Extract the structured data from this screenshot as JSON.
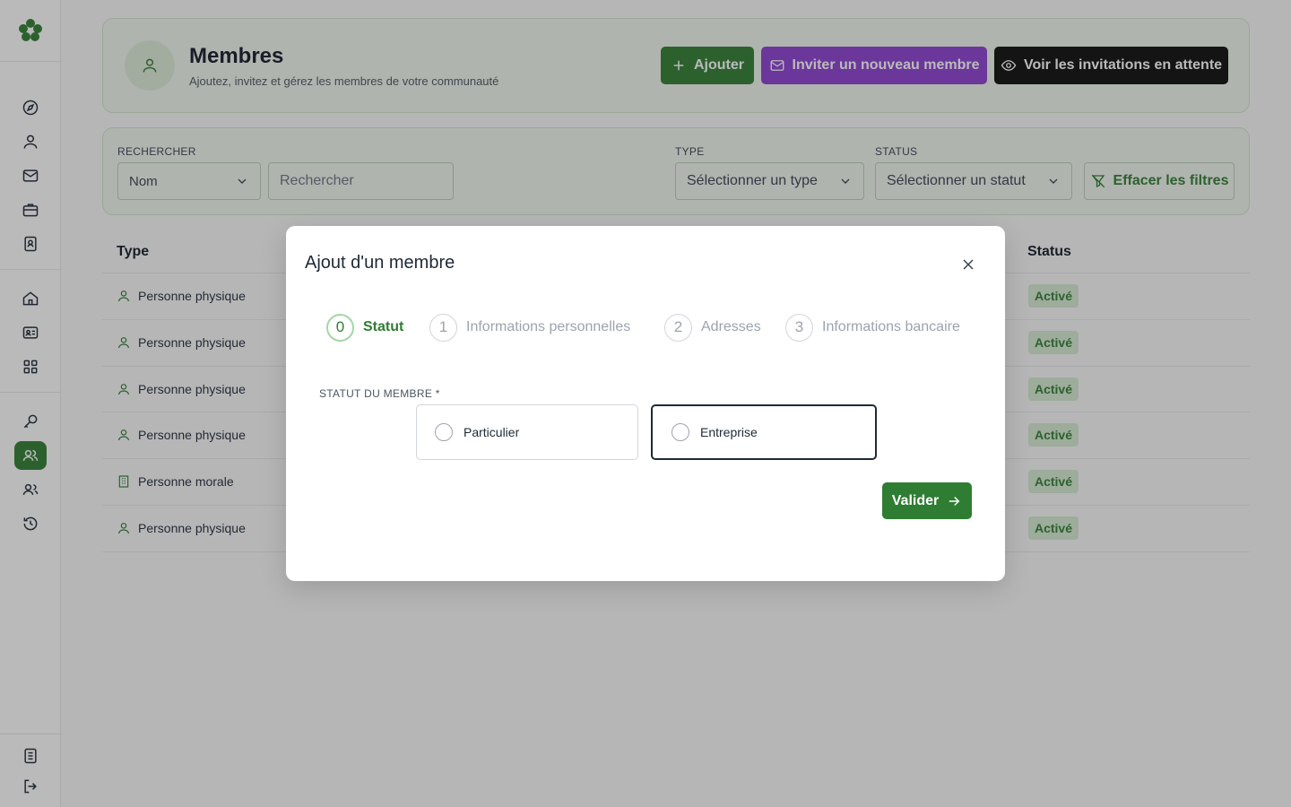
{
  "header": {
    "title": "Membres",
    "subtitle": "Ajoutez, invitez et gérez les membres de votre communauté",
    "add_label": "Ajouter",
    "invite_label": "Inviter un nouveau membre",
    "pending_label": "Voir les invitations en attente"
  },
  "filters": {
    "search_label": "RECHERCHER",
    "search_field_value": "Nom",
    "search_placeholder": "Rechercher",
    "type_label": "TYPE",
    "type_placeholder": "Sélectionner un type",
    "status_label": "STATUS",
    "status_placeholder": "Sélectionner un statut",
    "clear_label": "Effacer les filtres"
  },
  "table": {
    "headers": {
      "type": "Type",
      "status": "Status"
    },
    "rows": [
      {
        "type": "Personne physique",
        "icon": "user-icon",
        "status": "Activé"
      },
      {
        "type": "Personne physique",
        "icon": "user-icon",
        "status": "Activé"
      },
      {
        "type": "Personne physique",
        "icon": "user-icon",
        "status": "Activé"
      },
      {
        "type": "Personne physique",
        "icon": "user-icon",
        "status": "Activé"
      },
      {
        "type": "Personne morale",
        "icon": "building-icon",
        "status": "Activé"
      },
      {
        "type": "Personne physique",
        "icon": "user-icon",
        "status": "Activé"
      }
    ]
  },
  "modal": {
    "title": "Ajout d'un membre",
    "steps": [
      {
        "num": "0",
        "label": "Statut",
        "active": true
      },
      {
        "num": "1",
        "label": "Informations personnelles",
        "active": false
      },
      {
        "num": "2",
        "label": "Adresses",
        "active": false
      },
      {
        "num": "3",
        "label": "Informations bancaire",
        "active": false
      }
    ],
    "field_label": "STATUT DU MEMBRE *",
    "options": [
      {
        "label": "Particulier"
      },
      {
        "label": "Entreprise"
      }
    ],
    "submit_label": "Valider"
  },
  "colors": {
    "brand_green": "#2e7d32",
    "invite_purple": "#8b3fd1",
    "dark": "#0b0b0b"
  }
}
